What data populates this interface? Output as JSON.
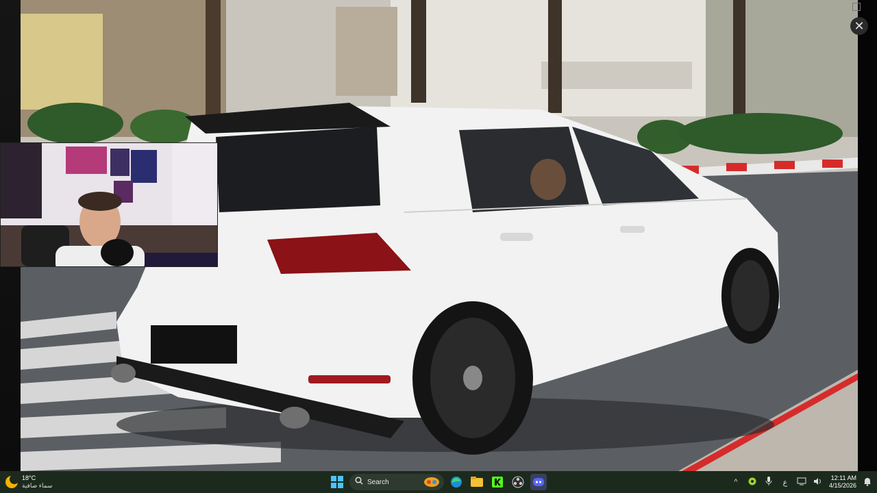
{
  "viewer": {
    "close_glyph": "✕"
  },
  "taskbar": {
    "weather": {
      "temperature": "18°C",
      "condition": "سماء صافية",
      "icon": "moon-icon"
    },
    "search": {
      "label": "Search"
    },
    "apps": [
      {
        "name": "windows-start-icon"
      },
      {
        "name": "search-icon"
      },
      {
        "name": "game-app-icon"
      },
      {
        "name": "edge-browser-icon"
      },
      {
        "name": "file-explorer-icon"
      },
      {
        "name": "kick-app-icon"
      },
      {
        "name": "obs-app-icon"
      },
      {
        "name": "discord-icon"
      }
    ],
    "tray": {
      "chevron": "^",
      "input_lang": "ع",
      "time": "12:11 AM",
      "date": "4/15/2026"
    }
  },
  "colors": {
    "taskbar_bg": "#1c2a1e",
    "car_white": "#f2f2f2",
    "curb_red": "#d62b2b",
    "discord": "#5865F2"
  }
}
